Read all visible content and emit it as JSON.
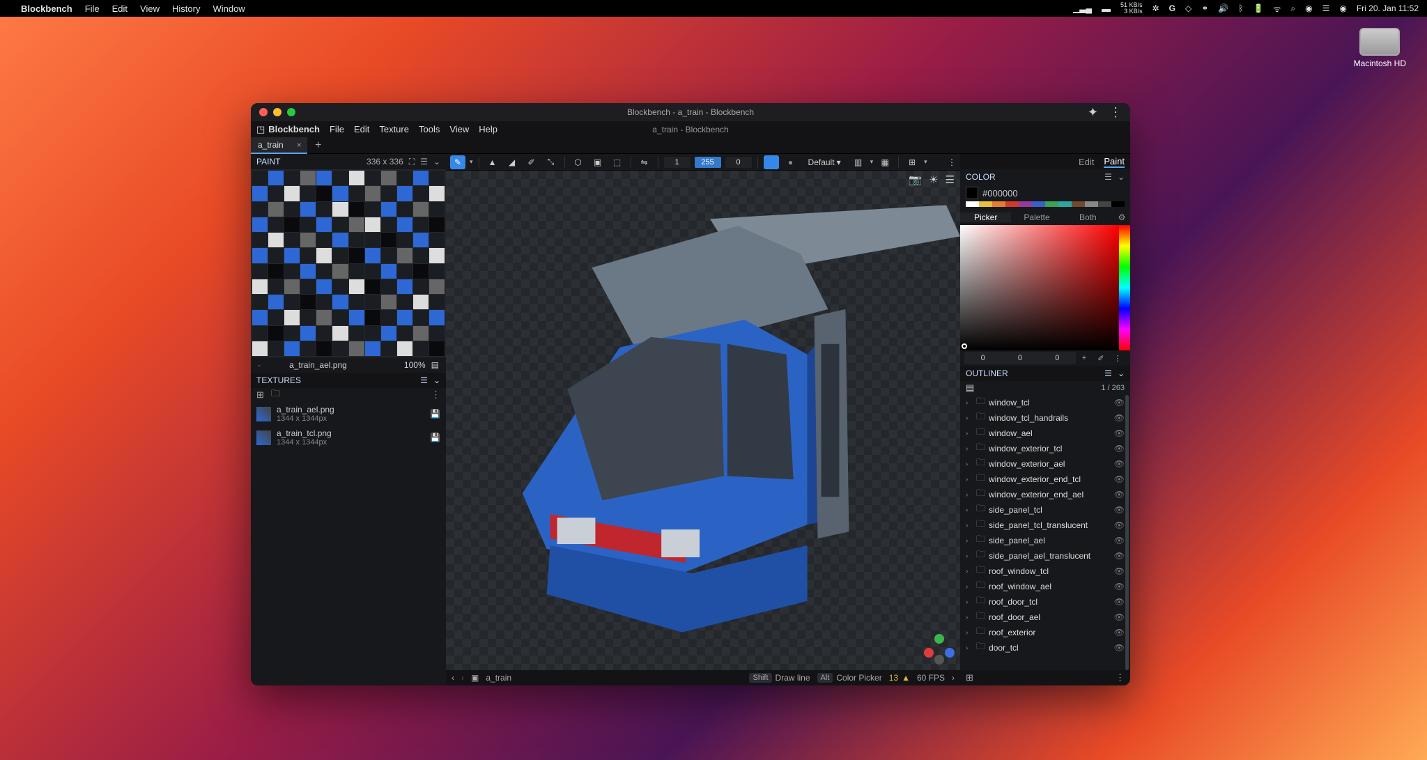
{
  "macmenu": {
    "app": "Blockbench",
    "items": [
      "File",
      "Edit",
      "View",
      "History",
      "Window"
    ],
    "datetime": "Fri 20. Jan  11:52",
    "net_down": "51 KB/s",
    "net_up": "3 KB/s"
  },
  "desktop": {
    "hd": "Macintosh HD"
  },
  "window": {
    "title": "Blockbench - a_train - Blockbench",
    "subtitle": "a_train - Blockbench"
  },
  "appmenu": {
    "brand": "Blockbench",
    "items": [
      "File",
      "Edit",
      "Texture",
      "Tools",
      "View",
      "Help"
    ]
  },
  "tab": {
    "name": "a_train"
  },
  "paint_panel": {
    "title": "PAINT",
    "res": "336 x 336",
    "uv_name": "a_train_ael.png",
    "uv_zoom": "100%"
  },
  "textures": {
    "title": "TEXTURES",
    "items": [
      {
        "name": "a_train_ael.png",
        "dim": "1344 x 1344px"
      },
      {
        "name": "a_train_tcl.png",
        "dim": "1344 x 1344px"
      }
    ]
  },
  "toolbar": {
    "v1": "1",
    "v2": "255",
    "v3": "0",
    "shape": "Default"
  },
  "modes": {
    "a": "Edit",
    "b": "Paint"
  },
  "color": {
    "title": "COLOR",
    "hex": "#000000",
    "tabs": {
      "a": "Picker",
      "b": "Palette",
      "c": "Both"
    },
    "rgb": [
      "0",
      "0",
      "0"
    ]
  },
  "outliner": {
    "title": "OUTLINER",
    "count": "1 / 263",
    "items": [
      "window_tcl",
      "window_tcl_handrails",
      "window_ael",
      "window_exterior_tcl",
      "window_exterior_ael",
      "window_exterior_end_tcl",
      "window_exterior_end_ael",
      "side_panel_tcl",
      "side_panel_tcl_translucent",
      "side_panel_ael",
      "side_panel_ael_translucent",
      "roof_window_tcl",
      "roof_window_ael",
      "roof_door_tcl",
      "roof_door_ael",
      "roof_exterior",
      "door_tcl"
    ]
  },
  "status": {
    "obj": "a_train",
    "shift": "Draw line",
    "alt": "Color Picker",
    "warn": "13",
    "fps": "60 FPS"
  }
}
